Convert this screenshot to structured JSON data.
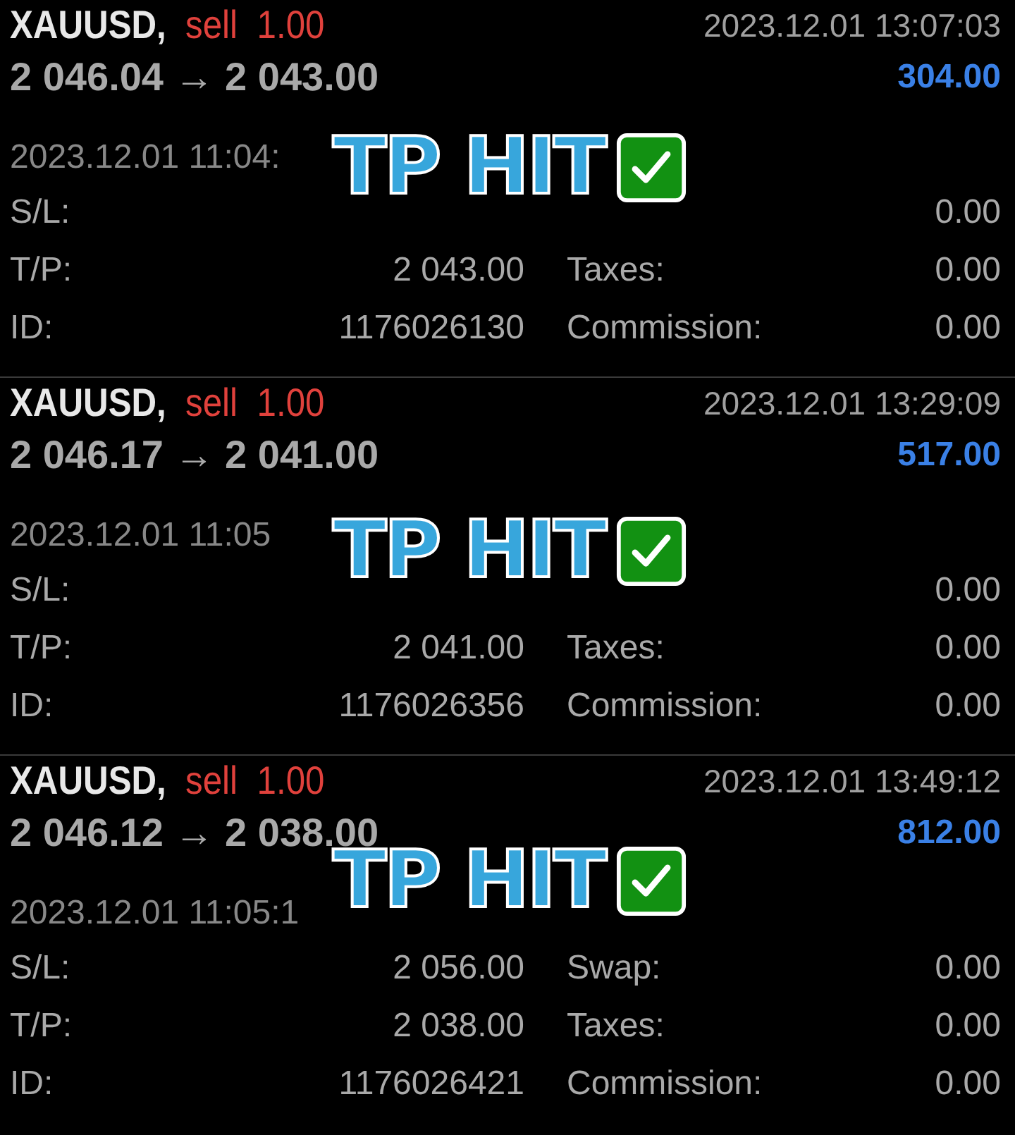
{
  "trades": [
    {
      "symbol": "XAUUSD,",
      "side": "sell",
      "volume": "1.00",
      "close_time": "2023.12.01 13:07:03",
      "prices": "2 046.04 → 2 043.00",
      "profit": "304.00",
      "open_time": "2023.12.01 11:04:",
      "overlay": "TP HIT",
      "rows": [
        {
          "label": "S/L:",
          "value2": "0.00"
        },
        {
          "label": "T/P:",
          "value": "2 043.00",
          "label2": "Taxes:",
          "value2": "0.00"
        },
        {
          "label": "ID:",
          "value": "1176026130",
          "label2": "Commission:",
          "value2": "0.00"
        }
      ]
    },
    {
      "symbol": "XAUUSD,",
      "side": "sell",
      "volume": "1.00",
      "close_time": "2023.12.01 13:29:09",
      "prices": "2 046.17 → 2 041.00",
      "profit": "517.00",
      "open_time": "2023.12.01 11:05",
      "overlay": "TP HIT",
      "rows": [
        {
          "label": "S/L:",
          "value2": "0.00"
        },
        {
          "label": "T/P:",
          "value": "2 041.00",
          "label2": "Taxes:",
          "value2": "0.00"
        },
        {
          "label": "ID:",
          "value": "1176026356",
          "label2": "Commission:",
          "value2": "0.00"
        }
      ]
    },
    {
      "symbol": "XAUUSD,",
      "side": "sell",
      "volume": "1.00",
      "close_time": "2023.12.01 13:49:12",
      "prices": "2 046.12 → 2 038.00",
      "profit": "812.00",
      "open_time": "2023.12.01 11:05:1",
      "overlay": "TP HIT",
      "rows": [
        {
          "label": "S/L:",
          "value": "2 056.00",
          "label2": "Swap:",
          "value2": "0.00"
        },
        {
          "label": "T/P:",
          "value": "2 038.00",
          "label2": "Taxes:",
          "value2": "0.00"
        },
        {
          "label": "ID:",
          "value": "1176026421",
          "label2": "Commission:",
          "value2": "0.00"
        }
      ]
    }
  ]
}
